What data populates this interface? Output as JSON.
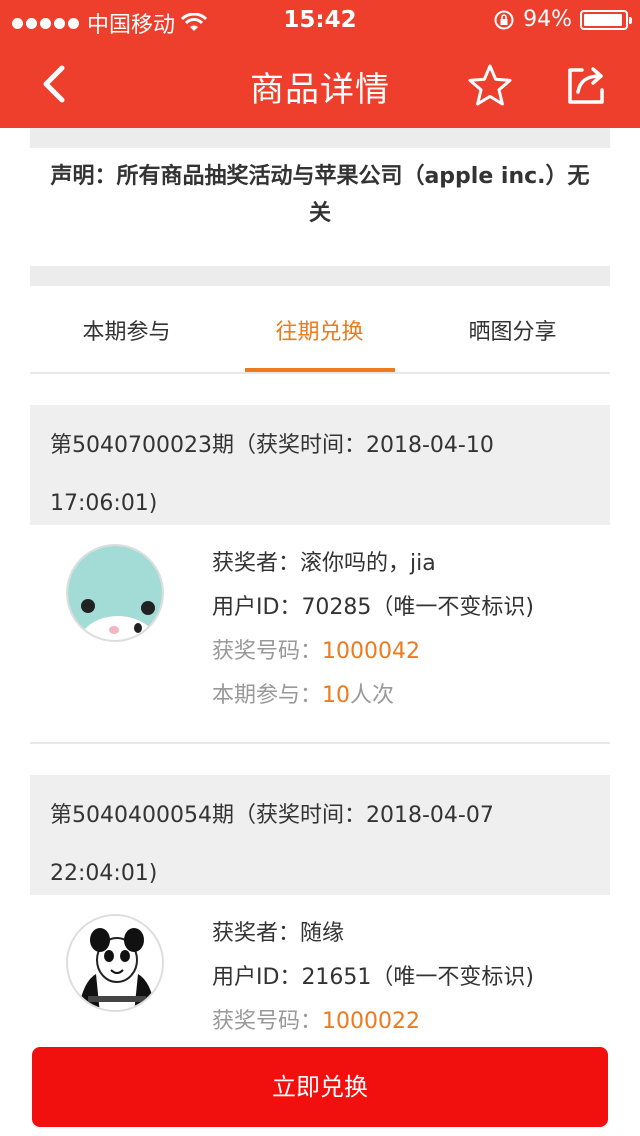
{
  "status_bar": {
    "carrier": "中国移动",
    "time": "15:42",
    "battery_percent_text": "94%",
    "battery_level": 0.94
  },
  "nav": {
    "title": "商品详情",
    "back_icon": "chevron-left-icon",
    "favorite_icon": "star-icon",
    "share_icon": "share-icon"
  },
  "disclaimer": {
    "line1": "声明：所有商品抽奖活动与苹果公司（apple inc.）无",
    "line2": "关"
  },
  "tabs": [
    {
      "label": "本期参与",
      "active": false
    },
    {
      "label": "往期兑换",
      "active": true
    },
    {
      "label": "晒图分享",
      "active": false
    }
  ],
  "periods": [
    {
      "header_line1": "第5040700023期（获奖时间：2018-04-10",
      "header_line2": "17:06:01)",
      "winner_label": "获奖者：",
      "winner_name": "滚你吗的，jia",
      "user_id_label": "用户ID：",
      "user_id": "70285（唯一不变标识)",
      "number_label": "获奖号码：",
      "number": "1000042",
      "joined_label": "本期参与：",
      "joined_count": "10",
      "joined_unit": "人次"
    },
    {
      "header_line1": "第5040400054期（获奖时间：2018-04-07",
      "header_line2": "22:04:01)",
      "winner_label": "获奖者：",
      "winner_name": "随缘",
      "user_id_label": "用户ID：",
      "user_id": "21651（唯一不变标识)",
      "number_label": "获奖号码：",
      "number": "1000022"
    }
  ],
  "cta": {
    "label": "立即兑换"
  },
  "colors": {
    "header_bg": "#ee3e2c",
    "accent_orange": "#ee7a1e",
    "cta_red": "#f1100e"
  }
}
